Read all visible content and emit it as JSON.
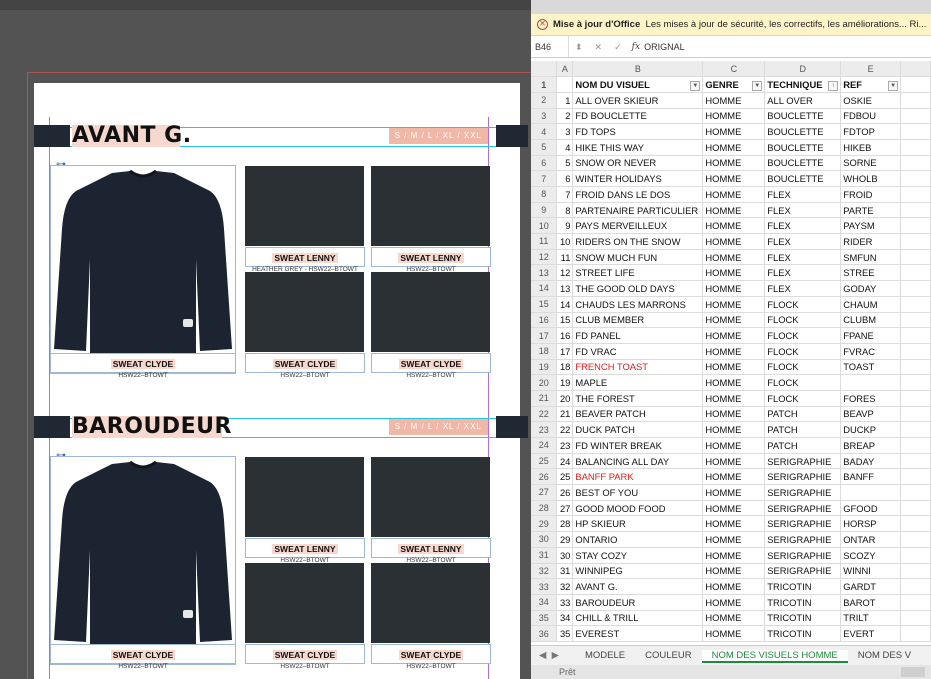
{
  "doc": {
    "sections": [
      {
        "title": "AVANT G.",
        "sizes": "S / M / L / XL / XXL",
        "captions": [
          {
            "title": "SWEAT CLYDE",
            "sub": "HSW22–BTOWT"
          },
          {
            "title": "SWEAT LENNY",
            "sub": "HEATHER GREY - HSW22–BTOWT"
          },
          {
            "title": "SWEAT LENNY",
            "sub": "HSW22–BTOWT"
          },
          {
            "title": "SWEAT CLYDE",
            "sub": "HSW22–BTOWT"
          },
          {
            "title": "SWEAT CLYDE",
            "sub": "HSW22–BTOWT"
          }
        ]
      },
      {
        "title": "BAROUDEUR",
        "sizes": "S / M / L / XL / XXL",
        "captions": [
          {
            "title": "SWEAT CLYDE",
            "sub": "HSW22–BTOWT"
          },
          {
            "title": "SWEAT LENNY",
            "sub": "HSW22–BTOWT"
          },
          {
            "title": "SWEAT LENNY",
            "sub": "HSW22–BTOWT"
          },
          {
            "title": "SWEAT CLYDE",
            "sub": "HSW22–BTOWT"
          },
          {
            "title": "SWEAT CLYDE",
            "sub": "HSW22–BTOWT"
          }
        ]
      }
    ]
  },
  "excel": {
    "update_bar": {
      "bold": "Mise à jour d'Office",
      "text": "Les mises à jour de sécurité, les correctifs, les améliorations... Ri..."
    },
    "name_box": "B46",
    "formula": "ORIGNAL",
    "fx_label": "fx",
    "columns": [
      "A",
      "B",
      "C",
      "D",
      "E"
    ],
    "header": {
      "row": "1",
      "a": "",
      "b": "NOM DU VISUEL",
      "c": "GENRE",
      "d": "TECHNIQUE",
      "e": "REF"
    },
    "rows": [
      [
        "2",
        "1",
        "ALL OVER SKIEUR",
        "HOMME",
        "ALL OVER",
        "OSKIE"
      ],
      [
        "3",
        "2",
        "FD BOUCLETTE",
        "HOMME",
        "BOUCLETTE",
        "FDBOU"
      ],
      [
        "4",
        "3",
        "FD TOPS",
        "HOMME",
        "BOUCLETTE",
        "FDTOP"
      ],
      [
        "5",
        "4",
        "HIKE THIS WAY",
        "HOMME",
        "BOUCLETTE",
        "HIKEB"
      ],
      [
        "6",
        "5",
        "SNOW OR NEVER",
        "HOMME",
        "BOUCLETTE",
        "SORNE"
      ],
      [
        "7",
        "6",
        "WINTER HOLIDAYS",
        "HOMME",
        "BOUCLETTE",
        "WHOLB"
      ],
      [
        "8",
        "7",
        "FROID DANS LE DOS",
        "HOMME",
        "FLEX",
        "FROID"
      ],
      [
        "9",
        "8",
        "PARTENAIRE PARTICULIER",
        "HOMME",
        "FLEX",
        "PARTE"
      ],
      [
        "10",
        "9",
        "PAYS MERVEILLEUX",
        "HOMME",
        "FLEX",
        "PAYSM"
      ],
      [
        "11",
        "10",
        "RIDERS ON THE SNOW",
        "HOMME",
        "FLEX",
        "RIDER"
      ],
      [
        "12",
        "11",
        "SNOW MUCH FUN",
        "HOMME",
        "FLEX",
        "SMFUN"
      ],
      [
        "13",
        "12",
        "STREET LIFE",
        "HOMME",
        "FLEX",
        "STREE"
      ],
      [
        "14",
        "13",
        "THE GOOD OLD DAYS",
        "HOMME",
        "FLEX",
        "GODAY"
      ],
      [
        "15",
        "14",
        "CHAUDS LES MARRONS",
        "HOMME",
        "FLOCK",
        "CHAUM"
      ],
      [
        "16",
        "15",
        "CLUB MEMBER",
        "HOMME",
        "FLOCK",
        "CLUBM"
      ],
      [
        "17",
        "16",
        "FD PANEL",
        "HOMME",
        "FLOCK",
        "FPANE"
      ],
      [
        "18",
        "17",
        "FD VRAC",
        "HOMME",
        "FLOCK",
        "FVRAC"
      ],
      [
        "19",
        "18",
        "FRENCH TOAST",
        "HOMME",
        "FLOCK",
        "TOAST"
      ],
      [
        "20",
        "19",
        "MAPLE",
        "HOMME",
        "FLOCK",
        ""
      ],
      [
        "21",
        "20",
        "THE FOREST",
        "HOMME",
        "FLOCK",
        "FORES"
      ],
      [
        "22",
        "21",
        "BEAVER PATCH",
        "HOMME",
        "PATCH",
        "BEAVP"
      ],
      [
        "23",
        "22",
        "DUCK PATCH",
        "HOMME",
        "PATCH",
        "DUCKP"
      ],
      [
        "24",
        "23",
        "FD WINTER BREAK",
        "HOMME",
        "PATCH",
        "BREAP"
      ],
      [
        "25",
        "24",
        "BALANCING ALL DAY",
        "HOMME",
        "SERIGRAPHIE",
        "BADAY"
      ],
      [
        "26",
        "25",
        "BANFF PARK",
        "HOMME",
        "SERIGRAPHIE",
        "BANFF"
      ],
      [
        "27",
        "26",
        "BEST OF YOU",
        "HOMME",
        "SERIGRAPHIE",
        ""
      ],
      [
        "28",
        "27",
        "GOOD MOOD FOOD",
        "HOMME",
        "SERIGRAPHIE",
        "GFOOD"
      ],
      [
        "29",
        "28",
        "HP SKIEUR",
        "HOMME",
        "SERIGRAPHIE",
        "HORSP"
      ],
      [
        "30",
        "29",
        "ONTARIO",
        "HOMME",
        "SERIGRAPHIE",
        "ONTAR"
      ],
      [
        "31",
        "30",
        "STAY COZY",
        "HOMME",
        "SERIGRAPHIE",
        "SCOZY"
      ],
      [
        "32",
        "31",
        "WINNIPEG",
        "HOMME",
        "SERIGRAPHIE",
        "WINNI"
      ],
      [
        "33",
        "32",
        "AVANT G.",
        "HOMME",
        "TRICOTIN",
        "GARDT"
      ],
      [
        "34",
        "33",
        "BAROUDEUR",
        "HOMME",
        "TRICOTIN",
        "BAROT"
      ],
      [
        "35",
        "34",
        "CHILL & TRILL",
        "HOMME",
        "TRICOTIN",
        "TRILT"
      ],
      [
        "36",
        "35",
        "EVEREST",
        "HOMME",
        "TRICOTIN",
        "EVERT"
      ]
    ],
    "red_rows": [
      "19",
      "26"
    ],
    "tabs": [
      "MODELE",
      "COULEUR",
      "NOM DES VISUELS HOMME",
      "NOM DES V"
    ],
    "active_tab": "NOM DES VISUELS HOMME",
    "status": "Prêt",
    "colors": {
      "active_tab": "#1e8a3e",
      "red_text": "#e02020",
      "update_bar": "#fff4c8"
    }
  }
}
